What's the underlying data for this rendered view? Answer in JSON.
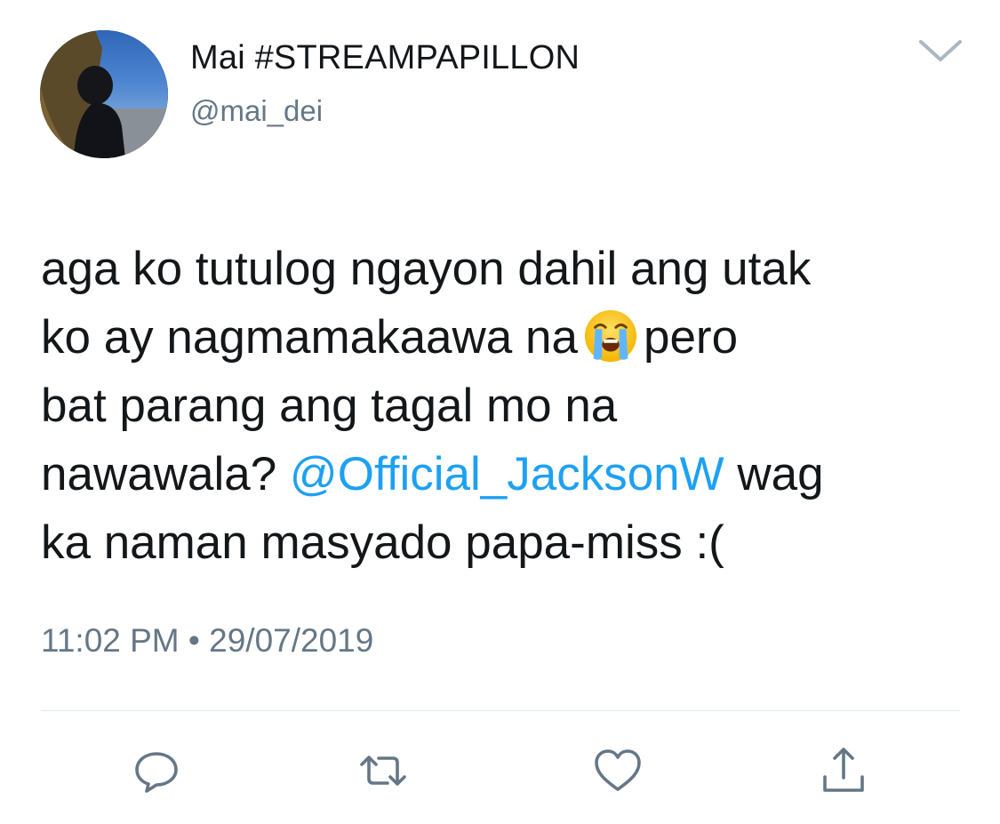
{
  "tweet": {
    "author": {
      "display_name": "Mai #STREAMPAPILLON",
      "handle": "@mai_dei",
      "avatar_icon": "profile-photo"
    },
    "text_lines": [
      [
        "aga ko tutulog ngayon dahil ang utak"
      ],
      [
        "ko ay nagmamakaawa na",
        "pero"
      ],
      [
        "bat parang ang tagal mo na"
      ],
      [
        "nawawala?",
        "@Official_JacksonW",
        "wag"
      ],
      [
        "ka naman masyado papa-miss :("
      ]
    ],
    "emoji_name": "loudly-crying-face-emoji",
    "mention": "@Official_JacksonW",
    "timestamp": "11:02 PM • 29/07/2019"
  },
  "actions": {
    "reply_icon": "reply-icon",
    "retweet_icon": "retweet-icon",
    "like_icon": "heart-icon",
    "share_icon": "share-icon",
    "menu_icon": "chevron-down-icon"
  },
  "colors": {
    "text": "#14171a",
    "secondary": "#657786",
    "link": "#1da1f2",
    "divider": "#e1e8ed"
  }
}
